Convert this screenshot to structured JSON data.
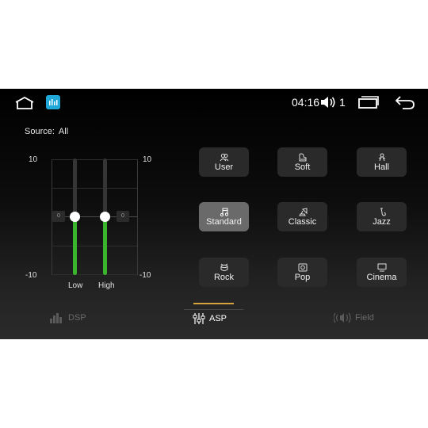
{
  "status": {
    "time": "04:16",
    "volume": "1"
  },
  "source": {
    "label": "Source:",
    "value": "All"
  },
  "eq": {
    "max_label": "10",
    "min_label": "-10",
    "zero_tag": "0",
    "bands": [
      {
        "label": "Low",
        "value": 0
      },
      {
        "label": "High",
        "value": 0
      }
    ]
  },
  "presets": [
    {
      "label": "User",
      "icon": "user-icon",
      "active": false
    },
    {
      "label": "Soft",
      "icon": "piano-icon",
      "active": false
    },
    {
      "label": "Hall",
      "icon": "hall-icon",
      "active": false
    },
    {
      "label": "Standard",
      "icon": "music-note-icon",
      "active": true
    },
    {
      "label": "Classic",
      "icon": "gramophone-icon",
      "active": false
    },
    {
      "label": "Jazz",
      "icon": "saxophone-icon",
      "active": false
    },
    {
      "label": "Rock",
      "icon": "drum-icon",
      "active": false
    },
    {
      "label": "Pop",
      "icon": "speaker-icon",
      "active": false
    },
    {
      "label": "Cinema",
      "icon": "screen-icon",
      "active": false
    }
  ],
  "nav": {
    "dsp": "DSP",
    "asp": "ASP",
    "field": "Field",
    "active": "ASP"
  },
  "colors": {
    "accent": "#3bb52b",
    "indicator": "#d6a33c",
    "app_icon": "#1fa8d8"
  }
}
